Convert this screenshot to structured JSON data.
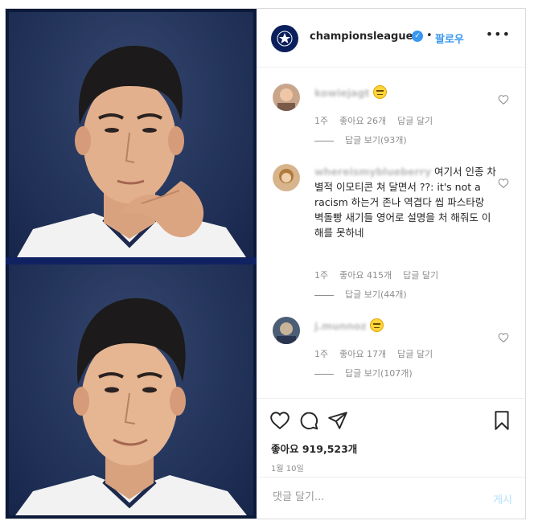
{
  "header": {
    "handle": "championsleague",
    "verified_icon": "verified-badge-icon",
    "separator": "•",
    "follow_label": "팔로우",
    "more_label": "•••"
  },
  "comments": [
    {
      "username": "kowiejagt",
      "text": "",
      "emoji": "grimacing-face-icon",
      "time": "1주",
      "likes": "좋아요 26개",
      "reply_label": "답글 달기",
      "view_replies": "답글 보기(93개)"
    },
    {
      "username": "whereismyblueberry",
      "text": "여기서 인종 차별적 이모티콘 쳐 달면서 ??: it's not a racism 하는거 존나 역겹다 씹 파스타랑 벽돌빵 새기들 영어로 설명을 처 해줘도 이해를 못하네",
      "time": "1주",
      "likes": "좋아요 415개",
      "reply_label": "답글 달기",
      "view_replies": "답글 보기(44개)"
    },
    {
      "username": "j.munnoz",
      "text": "",
      "emoji": "grimacing-face-icon",
      "time": "1주",
      "likes": "좋아요 17개",
      "reply_label": "답글 달기",
      "view_replies": "답글 보기(107개)"
    }
  ],
  "actions": {
    "likes": "좋아요 919,523개",
    "date": "1월 10일"
  },
  "comment_box": {
    "placeholder": "댓글 달기...",
    "post_label": "게시"
  },
  "colors": {
    "accent": "#3897f0",
    "photo_background": "#24355c",
    "border": "#dbdbdb"
  }
}
